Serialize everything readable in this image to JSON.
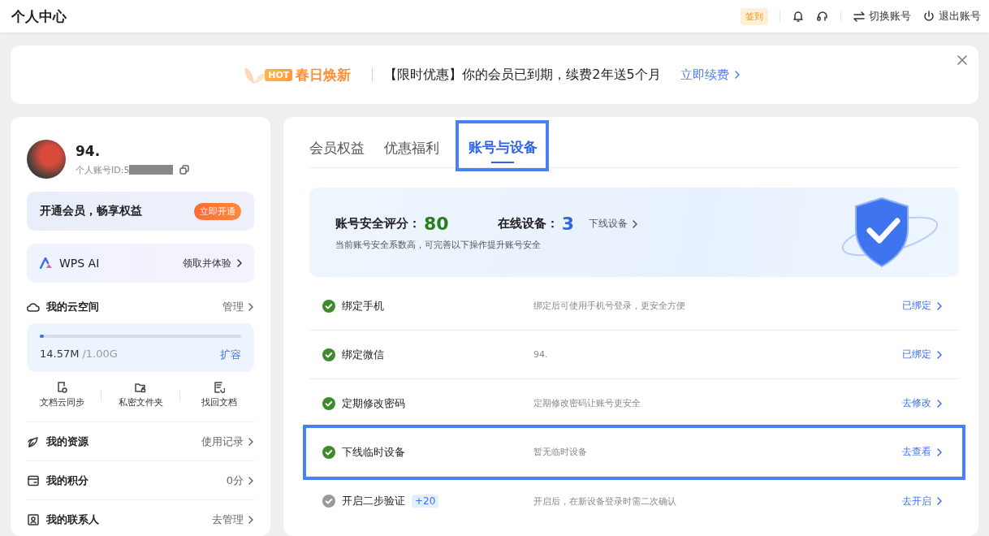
{
  "header": {
    "title": "个人中心",
    "checkin": "签到",
    "actions": [
      {
        "kind": "switch",
        "label": "切换账号"
      },
      {
        "kind": "logout",
        "label": "退出账号"
      }
    ]
  },
  "banner": {
    "hot": "HOT",
    "campaign": "春日焕新",
    "message": "【限时优惠】你的会员已到期，续费2年送5个月",
    "link": "立即续费"
  },
  "profile": {
    "name": "94.",
    "account_id": "个人账号ID:5",
    "id_redacted": true
  },
  "vip": {
    "text": "开通会员，畅享权益",
    "button": "立即开通"
  },
  "ai": {
    "label": "WPS AI",
    "link": "领取并体验"
  },
  "cloud": {
    "title": "我的云空间",
    "manage": "管理",
    "level": 0.015,
    "used": "14.57M",
    "total": "/1.00G",
    "expand": "扩容"
  },
  "tools": [
    {
      "kind": "sync",
      "label": "文档云同步"
    },
    {
      "kind": "private",
      "label": "私密文件夹"
    },
    {
      "kind": "recover",
      "label": "找回文档"
    }
  ],
  "menu": [
    {
      "kind": "resource",
      "label": "我的资源",
      "value": "使用记录"
    },
    {
      "kind": "points",
      "label": "我的积分",
      "value": "0分"
    },
    {
      "kind": "contacts",
      "label": "我的联系人",
      "value": "去管理"
    }
  ],
  "tabs": [
    {
      "label": "会员权益",
      "selected": false,
      "highlighted": false
    },
    {
      "label": "优惠福利",
      "selected": false,
      "highlighted": false
    },
    {
      "label": "账号与设备",
      "selected": true,
      "highlighted": true
    }
  ],
  "security": {
    "score_label": "账号安全评分：",
    "score": "80",
    "devices_label": "在线设备：",
    "devices": "3",
    "devices_link": "下线设备",
    "hint": "当前账号安全系数高，可完善以下操作提升账号安全"
  },
  "items": [
    {
      "title": "绑定手机",
      "desc": "绑定后可使用手机号登录，更安全方便",
      "action": "已绑定",
      "done": true,
      "highlighted": false
    },
    {
      "title": "绑定微信",
      "desc": "94.",
      "action": "已绑定",
      "done": true,
      "highlighted": false
    },
    {
      "title": "定期修改密码",
      "desc": "定期修改密码让账号更安全",
      "action": "去修改",
      "done": true,
      "highlighted": false
    },
    {
      "title": "下线临时设备",
      "desc": "暂无临时设备",
      "action": "去查看",
      "done": true,
      "highlighted": true
    },
    {
      "title": "开启二步验证",
      "badge": "+20",
      "desc": "开启后，在新设备登录时需二次确认",
      "action": "去开启",
      "done": false,
      "highlighted": false
    }
  ]
}
